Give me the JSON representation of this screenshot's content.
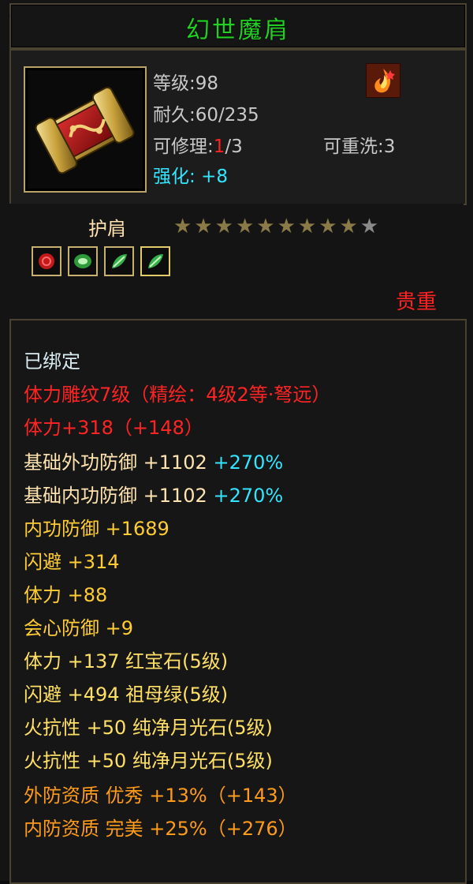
{
  "item": {
    "name": "幻世魔肩",
    "level": "等级:98",
    "durability": "耐久:60/235",
    "repair_prefix": "可修理:",
    "repair_current": "1",
    "repair_suffix": "/3",
    "rewash": "可重洗:3",
    "enhance_label": "强化:",
    "enhance_value": "+8",
    "slot": "护肩",
    "rarity": "贵重",
    "stars_filled": 9,
    "stars_total": 10
  },
  "gems": [
    "red-gem-icon",
    "green-gem-icon",
    "green-leaf-gem-icon",
    "green-leaf-gem-icon"
  ],
  "stats": [
    {
      "text": "已绑定",
      "color": "white"
    },
    {
      "text": "体力雕纹7级（精绘：4级2等·弩远）",
      "color": "red"
    },
    {
      "text": "体力+318（+148）",
      "color": "red"
    },
    {
      "text": "基础外功防御 +1102",
      "extra": "+270%",
      "color": "tan"
    },
    {
      "text": "基础内功防御 +1102",
      "extra": "+270%",
      "color": "tan"
    },
    {
      "text": "内功防御 +1689",
      "color": "yel"
    },
    {
      "text": "闪避 +314",
      "color": "yel"
    },
    {
      "text": "体力 +88",
      "color": "yel"
    },
    {
      "text": "会心防御 +9",
      "color": "yel"
    },
    {
      "text": "体力 +137 红宝石(5级)",
      "color": "yel2"
    },
    {
      "text": "闪避 +494 祖母绿(5级)",
      "color": "yel2"
    },
    {
      "text": "火抗性 +50 纯净月光石(5级)",
      "color": "yel2"
    },
    {
      "text": "火抗性 +50 纯净月光石(5级)",
      "color": "yel2"
    },
    {
      "text": "外防资质  优秀 +13%（+143）",
      "color": "org"
    },
    {
      "text": "内防资质  完美 +25%（+276）",
      "color": "org"
    }
  ]
}
